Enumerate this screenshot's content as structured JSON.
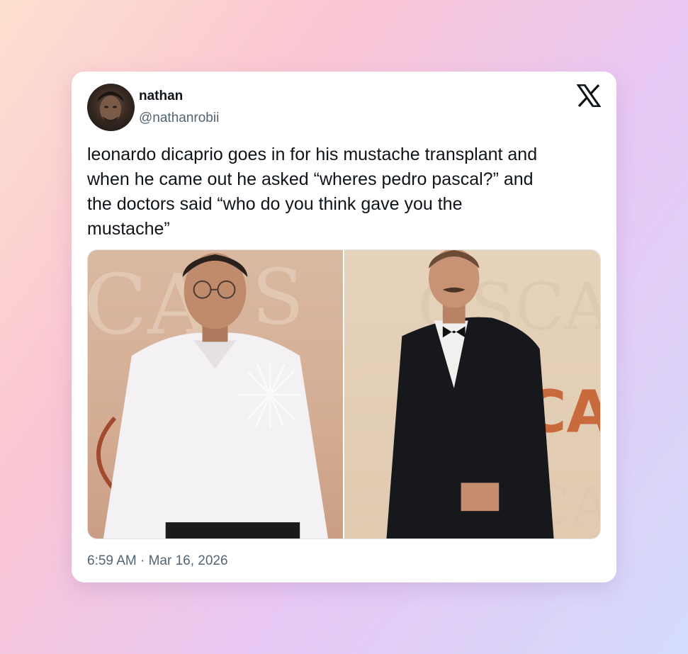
{
  "tweet": {
    "author": {
      "display_name": "nathan",
      "handle": "@nathanrobii",
      "avatar_icon": "profile-photo"
    },
    "platform_logo": "x-logo",
    "text_lines": [
      "leonardo dicaprio goes in for his mustache transplant and",
      "when he came out he asked “wheres pedro pascal?” and",
      "the doctors said “who do you think gave you the",
      "mustache”"
    ],
    "media": [
      {
        "kind": "photo",
        "subject": "man in white shirt with feather brooch"
      },
      {
        "kind": "photo",
        "subject": "man in black tuxedo with mustache"
      }
    ],
    "time": "6:59 AM",
    "separator": "·",
    "date": "Mar 16, 2026"
  },
  "colors": {
    "primary_text": "#0f1419",
    "secondary_text": "#536471",
    "card_background": "#ffffff"
  }
}
